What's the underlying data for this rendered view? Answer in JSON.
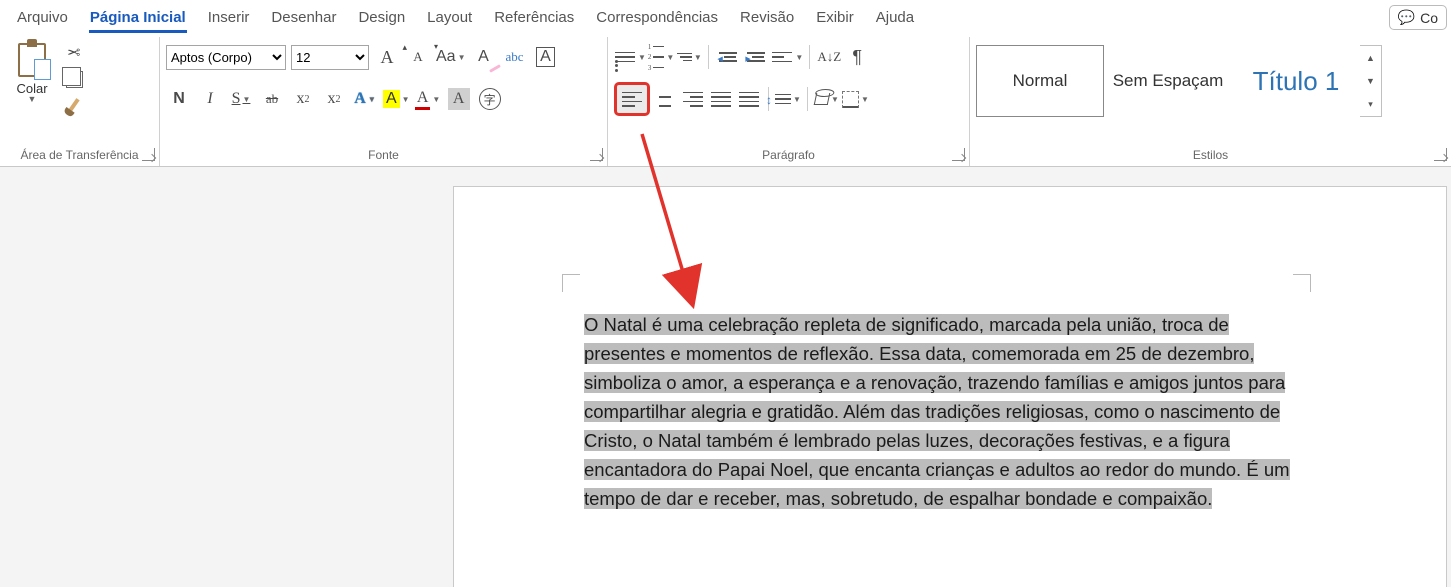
{
  "tabs": {
    "file": "Arquivo",
    "home": "Página Inicial",
    "insert": "Inserir",
    "draw": "Desenhar",
    "design": "Design",
    "layout": "Layout",
    "references": "Referências",
    "mailings": "Correspondências",
    "review": "Revisão",
    "view": "Exibir",
    "help": "Ajuda"
  },
  "topright": {
    "comments": "Co"
  },
  "clipboard": {
    "paste": "Colar",
    "group_label": "Área de Transferência"
  },
  "font": {
    "name_value": "Aptos (Corpo)",
    "size_value": "12",
    "group_label": "Fonte",
    "bold": "N",
    "italic": "I",
    "underline": "S",
    "strike": "ab",
    "sub": "x",
    "sup": "x",
    "effects": "A",
    "highlight": "A",
    "fontcolor": "A",
    "grow": "A",
    "shrink": "A",
    "changecase": "Aa",
    "clear": "A",
    "phonetic": "abc",
    "charborder": "A",
    "shading": "A",
    "enclose": "字"
  },
  "paragraph": {
    "group_label": "Parágrafo",
    "sort": "A↓Z",
    "marks": "¶"
  },
  "styles": {
    "group_label": "Estilos",
    "normal": "Normal",
    "nospacing": "Sem Espaçam",
    "heading1": "Título 1"
  },
  "document": {
    "text": "O Natal é uma celebração repleta de significado, marcada pela união, troca de presentes e momentos de reflexão. Essa data, comemorada em 25 de dezembro, simboliza o amor, a esperança e a renovação, trazendo famílias e amigos juntos para compartilhar alegria e gratidão. Além das tradições religiosas, como o nascimento de Cristo, o Natal também é lembrado pelas luzes, decorações festivas, e a figura encantadora do Papai Noel, que encanta crianças e adultos ao redor do mundo. É um tempo de dar e receber, mas, sobretudo, de espalhar bondade e compaixão."
  }
}
